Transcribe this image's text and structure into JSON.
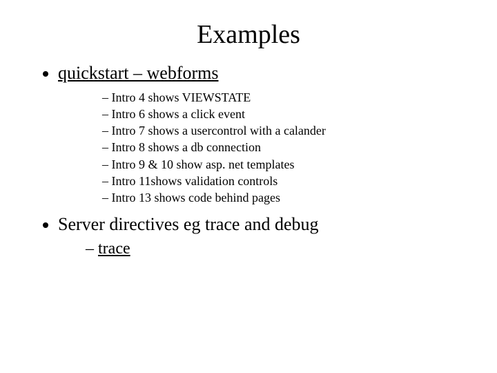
{
  "title": "Examples",
  "bullets": [
    {
      "text": "quickstart – webforms",
      "link": true,
      "sub": [
        "Intro 4 shows VIEWSTATE",
        "Intro 6 shows a click event",
        "Intro 7 shows a usercontrol with a calander",
        "Intro 8 shows a db connection",
        "Intro 9 & 10  show asp. net templates",
        "Intro 11shows validation controls",
        "Intro 13 shows code behind pages"
      ]
    },
    {
      "text": "Server directives eg trace and debug",
      "link": false,
      "sub2": [
        {
          "text": "trace",
          "link": true
        }
      ]
    }
  ]
}
